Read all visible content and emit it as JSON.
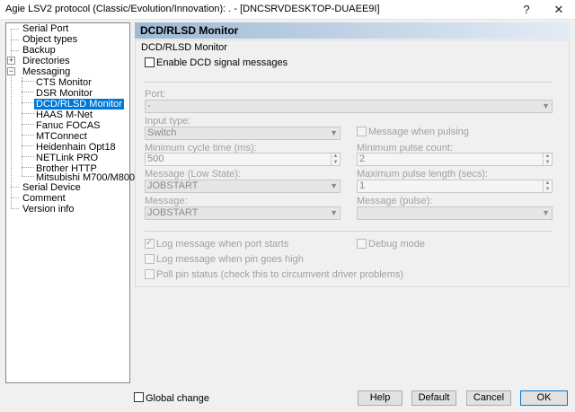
{
  "window": {
    "title": "Agie LSV2 protocol (Classic/Evolution/Innovation): . - [DNCSRVDESKTOP-DUAEE9I]",
    "help_glyph": "?",
    "close_glyph": "✕"
  },
  "tree": {
    "items": [
      {
        "label": "Serial Port"
      },
      {
        "label": "Object types"
      },
      {
        "label": "Backup"
      },
      {
        "label": "Directories",
        "expander": "+"
      },
      {
        "label": "Messaging",
        "expander": "−"
      },
      {
        "label": "CTS Monitor"
      },
      {
        "label": "DSR Monitor"
      },
      {
        "label": "DCD/RLSD Monitor",
        "selected": true
      },
      {
        "label": "HAAS M-Net"
      },
      {
        "label": "Fanuc FOCAS"
      },
      {
        "label": "MTConnect"
      },
      {
        "label": "Heidenhain Opt18"
      },
      {
        "label": "NETLink PRO"
      },
      {
        "label": "Brother HTTP"
      },
      {
        "label": "Mitsubishi M700/M800"
      },
      {
        "label": "Serial Device"
      },
      {
        "label": "Comment"
      },
      {
        "label": "Version info"
      }
    ]
  },
  "panel": {
    "header": "DCD/RLSD Monitor",
    "group_title": "DCD/RLSD Monitor",
    "enable_label": "Enable DCD signal messages",
    "port_label": "Port:",
    "port_value": "-",
    "input_type_label": "Input type:",
    "input_type_value": "Switch",
    "msg_when_pulsing_label": "Message when pulsing",
    "min_cycle_label": "Minimum cycle time (ms):",
    "min_cycle_value": "500",
    "min_pulse_label": "Minimum pulse count:",
    "min_pulse_value": "2",
    "msg_low_label": "Message (Low State):",
    "msg_low_value": "JOBSTART",
    "max_pulse_len_label": "Maximum pulse length (secs):",
    "max_pulse_len_value": "1",
    "message_label": "Message:",
    "message_value": "JOBSTART",
    "msg_pulse_label": "Message (pulse):",
    "msg_pulse_value": "",
    "log_port_starts_label": "Log message when port starts",
    "debug_mode_label": "Debug mode",
    "log_pin_high_label": "Log message when pin goes high",
    "poll_pin_label": "Poll pin status (check this to circumvent driver problems)"
  },
  "footer": {
    "global_change_label": "Global change",
    "help": "Help",
    "default": "Default",
    "cancel": "Cancel",
    "ok": "OK"
  }
}
